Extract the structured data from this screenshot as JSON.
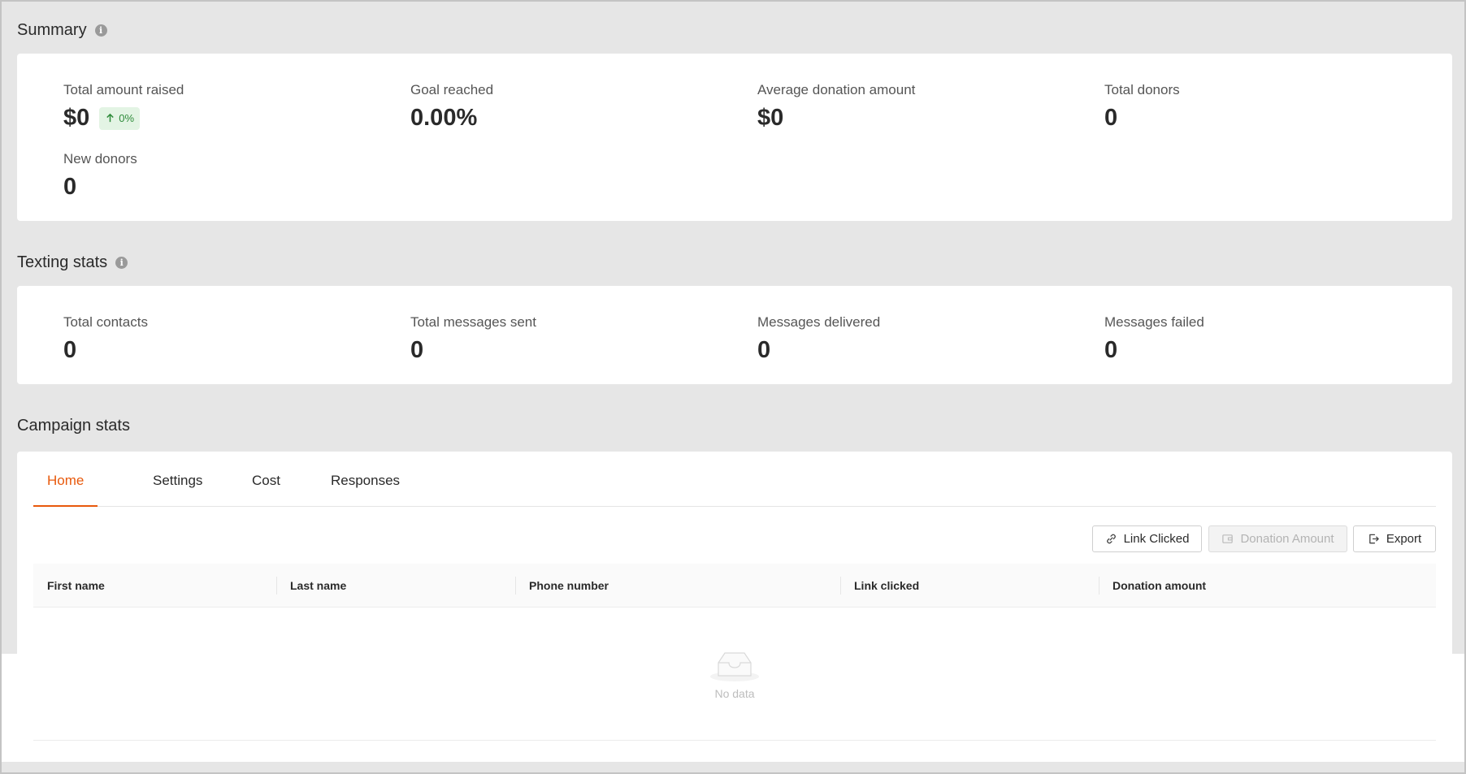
{
  "summary": {
    "title": "Summary",
    "stats": [
      {
        "label": "Total amount raised",
        "value": "$0",
        "badge": "0%"
      },
      {
        "label": "Goal reached",
        "value": "0.00%"
      },
      {
        "label": "Average donation amount",
        "value": "$0"
      },
      {
        "label": "Total donors",
        "value": "0"
      },
      {
        "label": "New donors",
        "value": "0"
      }
    ]
  },
  "texting": {
    "title": "Texting stats",
    "stats": [
      {
        "label": "Total contacts",
        "value": "0"
      },
      {
        "label": "Total messages sent",
        "value": "0"
      },
      {
        "label": "Messages delivered",
        "value": "0"
      },
      {
        "label": "Messages failed",
        "value": "0"
      }
    ]
  },
  "campaign": {
    "title": "Campaign stats",
    "tabs": [
      {
        "label": "Home",
        "active": true
      },
      {
        "label": "Settings"
      },
      {
        "label": "Cost"
      },
      {
        "label": "Responses"
      }
    ],
    "buttons": {
      "link_clicked": "Link Clicked",
      "donation_amount": "Donation Amount",
      "export": "Export"
    },
    "table": {
      "columns": [
        "First name",
        "Last name",
        "Phone number",
        "Link clicked",
        "Donation amount"
      ],
      "empty_text": "No data"
    }
  },
  "colors": {
    "accent": "#e8590c",
    "badge_bg": "#e3f4e4",
    "badge_text": "#2e8b3a",
    "page_bg": "#e6e6e6"
  },
  "icons": {
    "info": "info-icon",
    "arrow_up": "arrow-up-icon",
    "link": "link-icon",
    "wallet": "wallet-icon",
    "export": "export-icon",
    "empty": "empty-inbox-icon"
  }
}
